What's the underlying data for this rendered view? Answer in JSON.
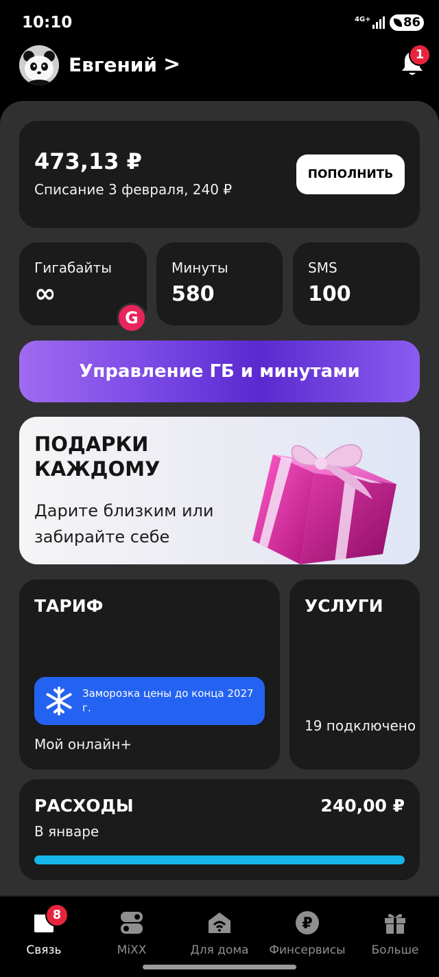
{
  "status_bar": {
    "time": "10:10",
    "network": "4G+",
    "battery": "86"
  },
  "header": {
    "user_name": "Евгений",
    "chevron": ">",
    "notifications_count": "1"
  },
  "balance": {
    "amount": "473,13 ₽",
    "charge_note": "Списание 3 февраля, 240 ₽",
    "topup_label": "ПОПОЛНИТЬ"
  },
  "counters": [
    {
      "label": "Гигабайты",
      "value": "∞"
    },
    {
      "label": "Минуты",
      "value": "580"
    },
    {
      "label": "SMS",
      "value": "100"
    }
  ],
  "g_badge": "G",
  "manage_button": "Управление ГБ и минутами",
  "promo": {
    "title": "ПОДАРКИ КАЖДОМУ",
    "text": "Дарите близким или забирайте себе"
  },
  "tariff": {
    "heading": "ТАРИФ",
    "freeze_text": "Заморозка цены до конца 2027 г.",
    "name": "Мой онлайн+"
  },
  "services": {
    "heading": "УСЛУГИ",
    "count_text": "19 подключено"
  },
  "expenses": {
    "heading": "РАСХОДЫ",
    "amount": "240,00 ₽",
    "period": "В январе",
    "progress": 1.0
  },
  "bottom_nav": [
    {
      "label": "Связь",
      "icon": "sim-icon",
      "badge": "8",
      "active": true
    },
    {
      "label": "MiXX",
      "icon": "mixx-icon"
    },
    {
      "label": "Для дома",
      "icon": "home-wifi-icon"
    },
    {
      "label": "Финсервисы",
      "icon": "ruble-icon"
    },
    {
      "label": "Больше",
      "icon": "gift-icon"
    }
  ],
  "colors": {
    "accent_purple": "#7846e4",
    "badge_red": "#e8243d",
    "freeze_blue": "#2463f1",
    "progress_cyan": "#16b6e8"
  }
}
